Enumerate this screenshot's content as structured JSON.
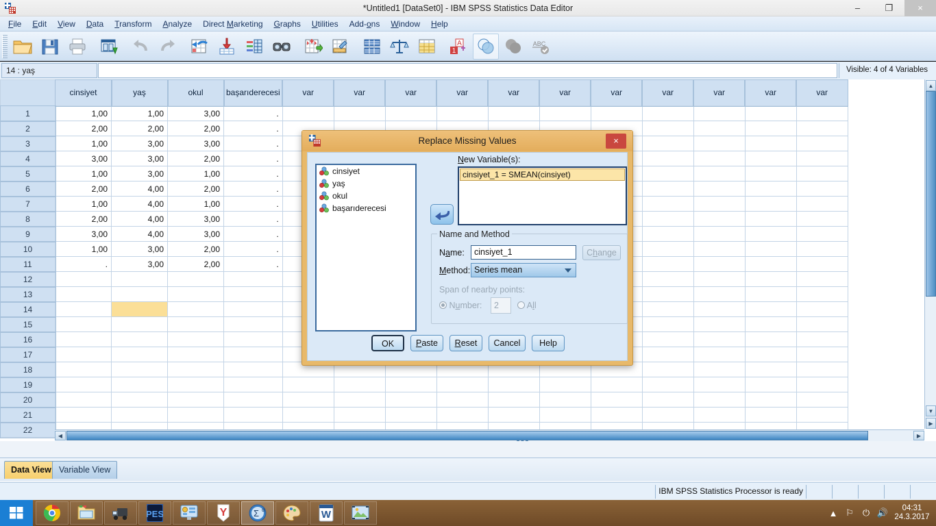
{
  "window": {
    "title": "*Untitled1 [DataSet0] - IBM SPSS Statistics Data Editor",
    "app_icon": "spss-icon",
    "minimize": "–",
    "maximize": "❐",
    "close": "×"
  },
  "menubar": {
    "items": [
      {
        "label": "File",
        "mnemonic": "F"
      },
      {
        "label": "Edit",
        "mnemonic": "E"
      },
      {
        "label": "View",
        "mnemonic": "V"
      },
      {
        "label": "Data",
        "mnemonic": "D"
      },
      {
        "label": "Transform",
        "mnemonic": "T"
      },
      {
        "label": "Analyze",
        "mnemonic": "A"
      },
      {
        "label": "Direct Marketing",
        "mnemonic": "M"
      },
      {
        "label": "Graphs",
        "mnemonic": "G"
      },
      {
        "label": "Utilities",
        "mnemonic": "U"
      },
      {
        "label": "Add-ons",
        "mnemonic": "o"
      },
      {
        "label": "Window",
        "mnemonic": "W"
      },
      {
        "label": "Help",
        "mnemonic": "H"
      }
    ]
  },
  "toolbar": {
    "buttons": [
      "open-file-icon",
      "save-icon",
      "print-icon",
      "recall-dialogs-icon",
      "undo-icon",
      "redo-icon",
      "goto-case-icon",
      "goto-variable-icon",
      "variables-icon",
      "find-icon",
      "insert-case-icon",
      "insert-variable-icon",
      "split-file-icon",
      "weight-cases-icon",
      "select-cases-icon",
      "value-labels-icon",
      "use-variable-sets-icon",
      "show-all-variables-icon",
      "spell-check-icon"
    ]
  },
  "cellbar": {
    "reference": "14 : yaş",
    "value": "",
    "visible_variables": "Visible: 4 of 4 Variables"
  },
  "grid": {
    "columns": [
      "cinsiyet",
      "yaş",
      "okul",
      "başarıderecesi"
    ],
    "placeholder_column_label": "var",
    "placeholder_column_count": 11,
    "rows": [
      {
        "n": "1",
        "values": [
          "1,00",
          "1,00",
          "3,00",
          "."
        ]
      },
      {
        "n": "2",
        "values": [
          "2,00",
          "2,00",
          "2,00",
          "."
        ]
      },
      {
        "n": "3",
        "values": [
          "1,00",
          "3,00",
          "3,00",
          "."
        ]
      },
      {
        "n": "4",
        "values": [
          "3,00",
          "3,00",
          "2,00",
          "."
        ]
      },
      {
        "n": "5",
        "values": [
          "1,00",
          "3,00",
          "1,00",
          "."
        ]
      },
      {
        "n": "6",
        "values": [
          "2,00",
          "4,00",
          "2,00",
          "."
        ]
      },
      {
        "n": "7",
        "values": [
          "1,00",
          "4,00",
          "1,00",
          "."
        ]
      },
      {
        "n": "8",
        "values": [
          "2,00",
          "4,00",
          "3,00",
          "."
        ]
      },
      {
        "n": "9",
        "values": [
          "3,00",
          "4,00",
          "3,00",
          "."
        ]
      },
      {
        "n": "10",
        "values": [
          "1,00",
          "3,00",
          "2,00",
          "."
        ]
      },
      {
        "n": "11",
        "values": [
          ".",
          "3,00",
          "2,00",
          "."
        ]
      },
      {
        "n": "12",
        "values": [
          "",
          "",
          "",
          ""
        ]
      },
      {
        "n": "13",
        "values": [
          "",
          "",
          "",
          ""
        ]
      },
      {
        "n": "14",
        "values": [
          "",
          "",
          "",
          ""
        ]
      },
      {
        "n": "15",
        "values": [
          "",
          "",
          "",
          ""
        ]
      },
      {
        "n": "16",
        "values": [
          "",
          "",
          "",
          ""
        ]
      },
      {
        "n": "17",
        "values": [
          "",
          "",
          "",
          ""
        ]
      },
      {
        "n": "18",
        "values": [
          "",
          "",
          "",
          ""
        ]
      },
      {
        "n": "19",
        "values": [
          "",
          "",
          "",
          ""
        ]
      },
      {
        "n": "20",
        "values": [
          "",
          "",
          "",
          ""
        ]
      },
      {
        "n": "21",
        "values": [
          "",
          "",
          "",
          ""
        ]
      },
      {
        "n": "22",
        "values": [
          "",
          "",
          "",
          ""
        ]
      }
    ],
    "selected_cell": {
      "row": "14",
      "column": "yaş"
    },
    "selection_color": "#fbdf97"
  },
  "dialog": {
    "title": "Replace Missing Values",
    "icon": "spss-dialog-icon",
    "close_label": "×",
    "source_variables": [
      "cinsiyet",
      "yaş",
      "okul",
      "başarıderecesi"
    ],
    "transfer_arrow": "arrow-left-icon",
    "new_variables_label": "New Variable(s):",
    "new_variables": [
      "cinsiyet_1 = SMEAN(cinsiyet)"
    ],
    "name_and_method": {
      "group_label": "Name and Method",
      "name_label": "Name:",
      "name_value": "cinsiyet_1",
      "change_label": "Change",
      "method_label": "Method:",
      "method_value": "Series mean",
      "span_label": "Span of nearby points:",
      "number_label": "Number:",
      "number_value": "2",
      "all_label": "All"
    },
    "buttons": [
      {
        "label": "OK",
        "mnemonic": ""
      },
      {
        "label": "Paste",
        "mnemonic": "P"
      },
      {
        "label": "Reset",
        "mnemonic": "R"
      },
      {
        "label": "Cancel",
        "mnemonic": ""
      },
      {
        "label": "Help",
        "mnemonic": ""
      }
    ]
  },
  "view_tabs": [
    {
      "label": "Data View",
      "active": true
    },
    {
      "label": "Variable View",
      "active": false
    }
  ],
  "statusbar": {
    "message": "IBM SPSS Statistics Processor is ready"
  },
  "taskbar": {
    "start_icon": "windows-start-icon",
    "items": [
      {
        "name": "chrome-icon",
        "active": false
      },
      {
        "name": "file-explorer-icon",
        "active": false
      },
      {
        "name": "euro-truck-icon",
        "active": false
      },
      {
        "name": "pes-icon",
        "active": false
      },
      {
        "name": "control-panel-icon",
        "active": false
      },
      {
        "name": "yandex-icon",
        "active": false
      },
      {
        "name": "spss-icon",
        "active": true
      },
      {
        "name": "paint-icon",
        "active": false
      },
      {
        "name": "word-icon",
        "active": false
      },
      {
        "name": "photo-viewer-icon",
        "active": false
      }
    ],
    "tray": [
      "show-hidden-icons",
      "flag-icon",
      "battery-icon",
      "volume-icon"
    ],
    "clock_time": "04:31",
    "clock_date": "24.3.2017"
  }
}
